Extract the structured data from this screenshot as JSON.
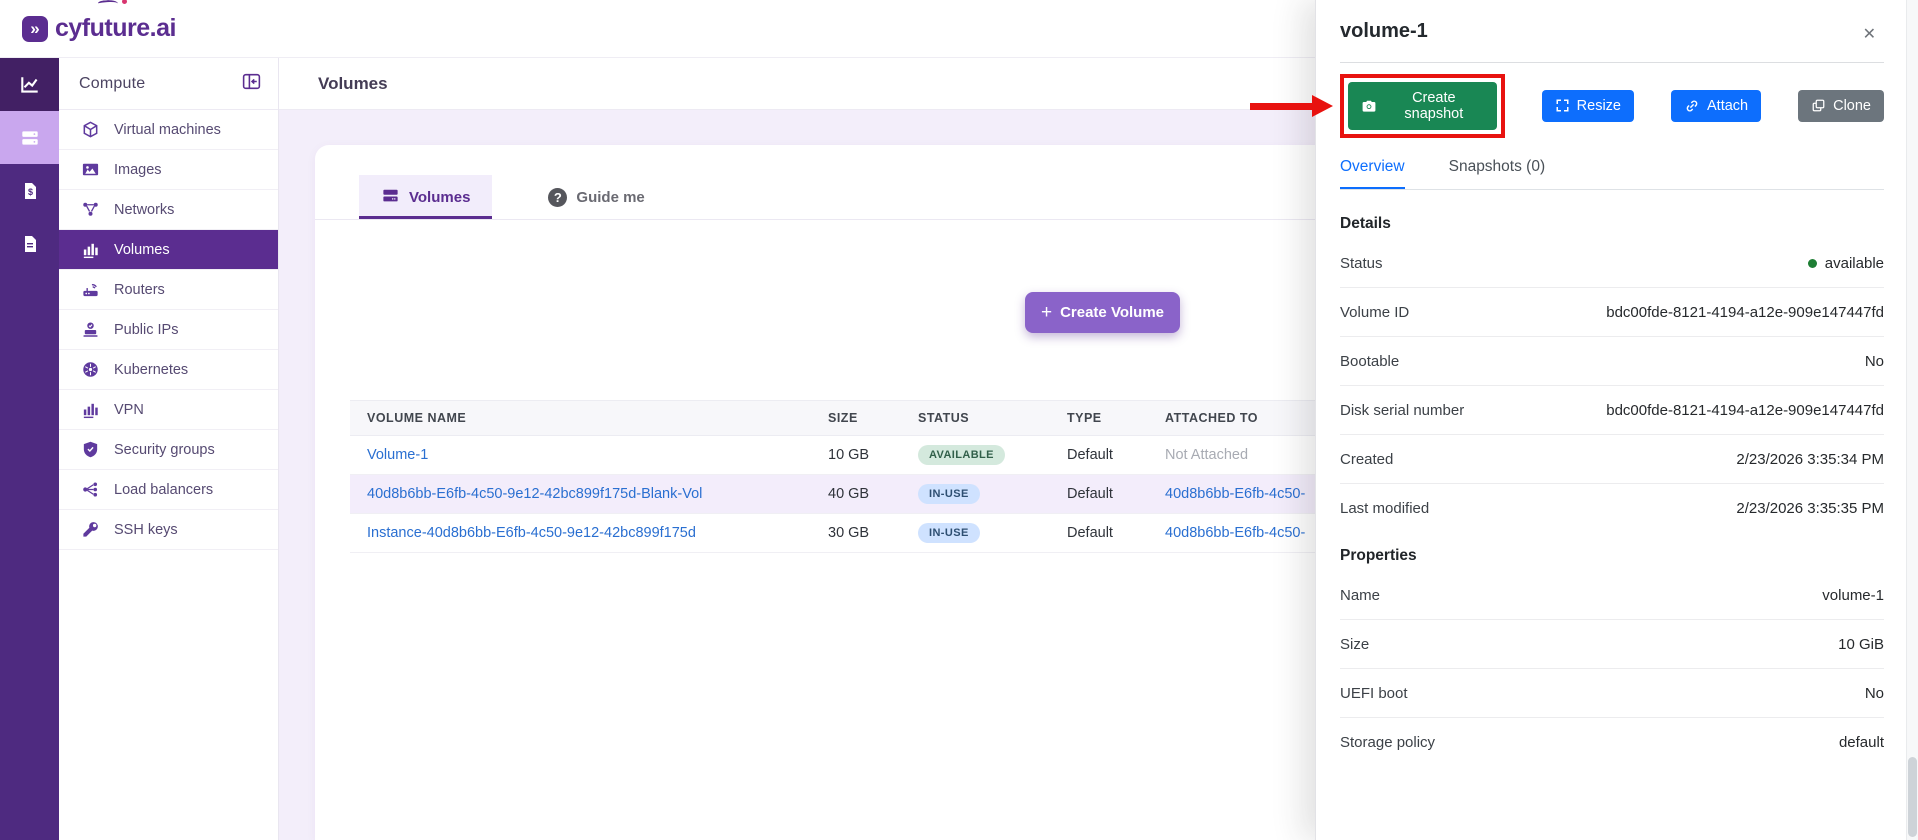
{
  "brand": {
    "name": "cyfuture.ai",
    "mark_glyph": "»",
    "purple": "#5b2d90"
  },
  "icons": {
    "close": "✕",
    "plus": "+",
    "question": "?",
    "status_dot": "●",
    "rail": [
      "line-chart",
      "servers",
      "billing-document",
      "report-document"
    ]
  },
  "sidebar": {
    "title": "Compute",
    "selected_index": 3,
    "items": [
      {
        "label": "Virtual machines",
        "icon": "cube"
      },
      {
        "label": "Images",
        "icon": "image"
      },
      {
        "label": "Networks",
        "icon": "network"
      },
      {
        "label": "Volumes",
        "icon": "bar-chart"
      },
      {
        "label": "Routers",
        "icon": "router"
      },
      {
        "label": "Public IPs",
        "icon": "public-ip"
      },
      {
        "label": "Kubernetes",
        "icon": "kubernetes-wheel"
      },
      {
        "label": "VPN",
        "icon": "bar-chart"
      },
      {
        "label": "Security groups",
        "icon": "shield-check"
      },
      {
        "label": "Load balancers",
        "icon": "load-balancer"
      },
      {
        "label": "SSH keys",
        "icon": "key"
      }
    ]
  },
  "page": {
    "title": "Volumes"
  },
  "tabs": [
    {
      "label": "Volumes",
      "active": true,
      "icon": "server-stack"
    },
    {
      "label": "Guide me",
      "active": false,
      "icon": "question-circle"
    }
  ],
  "create_volume": {
    "label": "Create Volume"
  },
  "table": {
    "columns": [
      "VOLUME NAME",
      "SIZE",
      "STATUS",
      "TYPE",
      "ATTACHED TO"
    ],
    "rows": [
      {
        "name": "Volume-1",
        "size": "10 GB",
        "status": "AVAILABLE",
        "status_kind": "available",
        "type": "Default",
        "attached": "Not Attached",
        "attached_is_link": false
      },
      {
        "name": "40d8b6bb-E6fb-4c50-9e12-42bc899f175d-Blank-Vol",
        "size": "40 GB",
        "status": "IN-USE",
        "status_kind": "in-use",
        "type": "Default",
        "attached": "40d8b6bb-E6fb-4c50-",
        "attached_is_link": true
      },
      {
        "name": "Instance-40d8b6bb-E6fb-4c50-9e12-42bc899f175d",
        "size": "30 GB",
        "status": "IN-USE",
        "status_kind": "in-use",
        "type": "Default",
        "attached": "40d8b6bb-E6fb-4c50-",
        "attached_is_link": true
      }
    ]
  },
  "annotation": {
    "type": "red-arrow-and-box",
    "target": "Create snapshot button",
    "color": "#e8120f"
  },
  "panel": {
    "title": "volume-1",
    "actions": {
      "create_snapshot": "Create snapshot",
      "resize": "Resize",
      "attach": "Attach",
      "clone": "Clone"
    },
    "action_colors": {
      "create_snapshot": "#198754",
      "resize": "#0d6efd",
      "attach": "#0d6efd",
      "clone": "#6c757d"
    },
    "tabs": {
      "overview": "Overview",
      "snapshots": "Snapshots (0)"
    },
    "details": {
      "heading": "Details",
      "rows": [
        {
          "label": "Status",
          "value": "available",
          "dot_color": "#198754"
        },
        {
          "label": "Volume ID",
          "value": "bdc00fde-8121-4194-a12e-909e147447fd"
        },
        {
          "label": "Bootable",
          "value": "No"
        },
        {
          "label": "Disk serial number",
          "value": "bdc00fde-8121-4194-a12e-909e147447fd"
        },
        {
          "label": "Created",
          "value": "2/23/2026 3:35:34 PM"
        },
        {
          "label": "Last modified",
          "value": "2/23/2026 3:35:35 PM"
        }
      ]
    },
    "properties": {
      "heading": "Properties",
      "rows": [
        {
          "label": "Name",
          "value": "volume-1"
        },
        {
          "label": "Size",
          "value": "10 GiB"
        },
        {
          "label": "UEFI boot",
          "value": "No"
        },
        {
          "label": "Storage policy",
          "value": "default"
        }
      ]
    }
  }
}
